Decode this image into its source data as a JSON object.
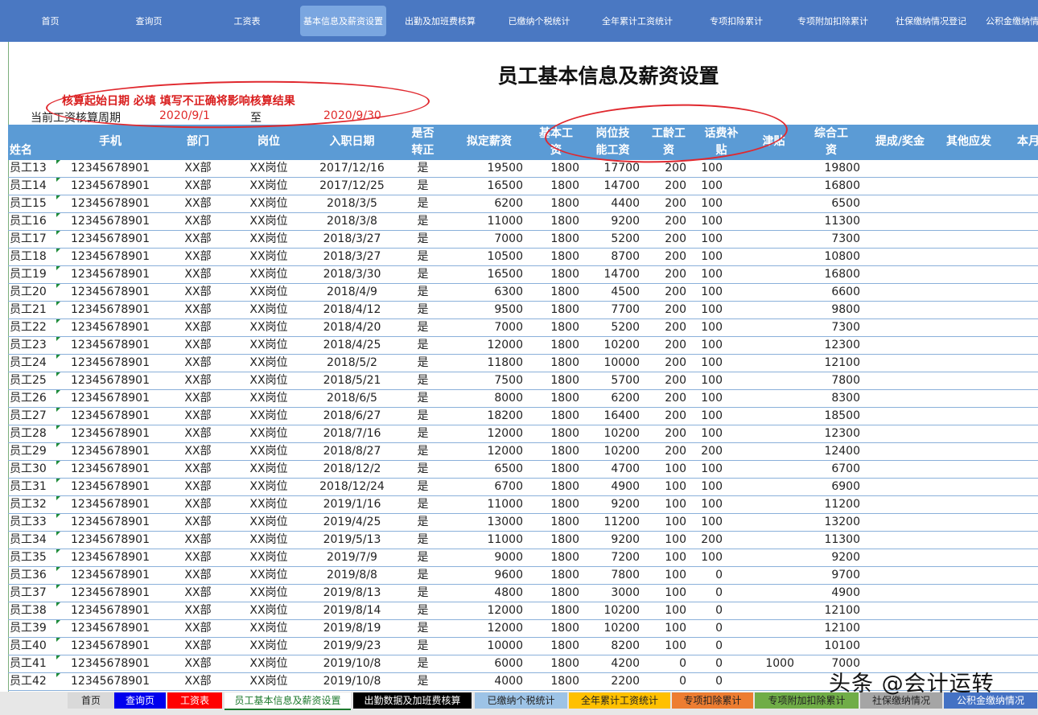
{
  "nav": {
    "items": [
      "首页",
      "查询页",
      "工资表",
      "基本信息及薪资设置",
      "出勤及加班费核算",
      "已缴纳个税统计",
      "全年累计工资统计",
      "专项扣除累计",
      "专项附加扣除累计",
      "社保缴纳情况登记",
      "公积金缴纳情"
    ],
    "active_index": 3
  },
  "page": {
    "title": "员工基本信息及薪资设置",
    "warning": "核算起始日期 必填 填写不正确将影响核算结果",
    "period_label": "当前工资核算周期",
    "period_start": "2020/9/1",
    "period_to": "至",
    "period_end": "2020/9/30"
  },
  "table": {
    "headers": [
      "姓名",
      "手机",
      "部门",
      "岗位",
      "入职日期",
      "是否\n转正",
      "拟定薪资",
      "基本工\n资",
      "岗位技\n能工资",
      "工龄工\n资",
      "话费补\n贴",
      "津贴",
      "综合工\n资",
      "提成/奖金",
      "其他应发",
      "本月"
    ],
    "rows": [
      [
        "员工13",
        "12345678901",
        "XX部",
        "XX岗位",
        "2017/12/16",
        "是",
        "19500",
        "1800",
        "17700",
        "200",
        "100",
        "",
        "19800"
      ],
      [
        "员工14",
        "12345678901",
        "XX部",
        "XX岗位",
        "2017/12/25",
        "是",
        "16500",
        "1800",
        "14700",
        "200",
        "100",
        "",
        "16800"
      ],
      [
        "员工15",
        "12345678901",
        "XX部",
        "XX岗位",
        "2018/3/5",
        "是",
        "6200",
        "1800",
        "4400",
        "200",
        "100",
        "",
        "6500"
      ],
      [
        "员工16",
        "12345678901",
        "XX部",
        "XX岗位",
        "2018/3/8",
        "是",
        "11000",
        "1800",
        "9200",
        "200",
        "100",
        "",
        "11300"
      ],
      [
        "员工17",
        "12345678901",
        "XX部",
        "XX岗位",
        "2018/3/27",
        "是",
        "7000",
        "1800",
        "5200",
        "200",
        "100",
        "",
        "7300"
      ],
      [
        "员工18",
        "12345678901",
        "XX部",
        "XX岗位",
        "2018/3/27",
        "是",
        "10500",
        "1800",
        "8700",
        "200",
        "100",
        "",
        "10800"
      ],
      [
        "员工19",
        "12345678901",
        "XX部",
        "XX岗位",
        "2018/3/30",
        "是",
        "16500",
        "1800",
        "14700",
        "200",
        "100",
        "",
        "16800"
      ],
      [
        "员工20",
        "12345678901",
        "XX部",
        "XX岗位",
        "2018/4/9",
        "是",
        "6300",
        "1800",
        "4500",
        "200",
        "100",
        "",
        "6600"
      ],
      [
        "员工21",
        "12345678901",
        "XX部",
        "XX岗位",
        "2018/4/12",
        "是",
        "9500",
        "1800",
        "7700",
        "200",
        "100",
        "",
        "9800"
      ],
      [
        "员工22",
        "12345678901",
        "XX部",
        "XX岗位",
        "2018/4/20",
        "是",
        "7000",
        "1800",
        "5200",
        "200",
        "100",
        "",
        "7300"
      ],
      [
        "员工23",
        "12345678901",
        "XX部",
        "XX岗位",
        "2018/4/25",
        "是",
        "12000",
        "1800",
        "10200",
        "200",
        "100",
        "",
        "12300"
      ],
      [
        "员工24",
        "12345678901",
        "XX部",
        "XX岗位",
        "2018/5/2",
        "是",
        "11800",
        "1800",
        "10000",
        "200",
        "100",
        "",
        "12100"
      ],
      [
        "员工25",
        "12345678901",
        "XX部",
        "XX岗位",
        "2018/5/21",
        "是",
        "7500",
        "1800",
        "5700",
        "200",
        "100",
        "",
        "7800"
      ],
      [
        "员工26",
        "12345678901",
        "XX部",
        "XX岗位",
        "2018/6/5",
        "是",
        "8000",
        "1800",
        "6200",
        "200",
        "100",
        "",
        "8300"
      ],
      [
        "员工27",
        "12345678901",
        "XX部",
        "XX岗位",
        "2018/6/27",
        "是",
        "18200",
        "1800",
        "16400",
        "200",
        "100",
        "",
        "18500"
      ],
      [
        "员工28",
        "12345678901",
        "XX部",
        "XX岗位",
        "2018/7/16",
        "是",
        "12000",
        "1800",
        "10200",
        "200",
        "100",
        "",
        "12300"
      ],
      [
        "员工29",
        "12345678901",
        "XX部",
        "XX岗位",
        "2018/8/27",
        "是",
        "12000",
        "1800",
        "10200",
        "200",
        "200",
        "",
        "12400"
      ],
      [
        "员工30",
        "12345678901",
        "XX部",
        "XX岗位",
        "2018/12/2",
        "是",
        "6500",
        "1800",
        "4700",
        "100",
        "100",
        "",
        "6700"
      ],
      [
        "员工31",
        "12345678901",
        "XX部",
        "XX岗位",
        "2018/12/24",
        "是",
        "6700",
        "1800",
        "4900",
        "100",
        "100",
        "",
        "6900"
      ],
      [
        "员工32",
        "12345678901",
        "XX部",
        "XX岗位",
        "2019/1/16",
        "是",
        "11000",
        "1800",
        "9200",
        "100",
        "100",
        "",
        "11200"
      ],
      [
        "员工33",
        "12345678901",
        "XX部",
        "XX岗位",
        "2019/4/25",
        "是",
        "13000",
        "1800",
        "11200",
        "100",
        "100",
        "",
        "13200"
      ],
      [
        "员工34",
        "12345678901",
        "XX部",
        "XX岗位",
        "2019/5/13",
        "是",
        "11000",
        "1800",
        "9200",
        "100",
        "200",
        "",
        "11300"
      ],
      [
        "员工35",
        "12345678901",
        "XX部",
        "XX岗位",
        "2019/7/9",
        "是",
        "9000",
        "1800",
        "7200",
        "100",
        "100",
        "",
        "9200"
      ],
      [
        "员工36",
        "12345678901",
        "XX部",
        "XX岗位",
        "2019/8/8",
        "是",
        "9600",
        "1800",
        "7800",
        "100",
        "0",
        "",
        "9700"
      ],
      [
        "员工37",
        "12345678901",
        "XX部",
        "XX岗位",
        "2019/8/13",
        "是",
        "4800",
        "1800",
        "3000",
        "100",
        "0",
        "",
        "4900"
      ],
      [
        "员工38",
        "12345678901",
        "XX部",
        "XX岗位",
        "2019/8/14",
        "是",
        "12000",
        "1800",
        "10200",
        "100",
        "0",
        "",
        "12100"
      ],
      [
        "员工39",
        "12345678901",
        "XX部",
        "XX岗位",
        "2019/8/19",
        "是",
        "12000",
        "1800",
        "10200",
        "100",
        "0",
        "",
        "12100"
      ],
      [
        "员工40",
        "12345678901",
        "XX部",
        "XX岗位",
        "2019/9/23",
        "是",
        "10000",
        "1800",
        "8200",
        "100",
        "0",
        "",
        "10100"
      ],
      [
        "员工41",
        "12345678901",
        "XX部",
        "XX岗位",
        "2019/10/8",
        "是",
        "6000",
        "1800",
        "4200",
        "0",
        "0",
        "1000",
        "7000"
      ],
      [
        "员工42",
        "12345678901",
        "XX部",
        "XX岗位",
        "2019/10/8",
        "是",
        "4000",
        "1800",
        "2200",
        "0",
        "0",
        "",
        ""
      ]
    ]
  },
  "sheet_tabs": [
    {
      "label": "首页",
      "bg": "#d9d9d9",
      "color": "#222"
    },
    {
      "label": "查询页",
      "bg": "#0000ee",
      "color": "#ffffff"
    },
    {
      "label": "工资表",
      "bg": "#ff0000",
      "color": "#ffffff"
    },
    {
      "label": "员工基本信息及薪资设置",
      "bg": "#ffffff",
      "color": "#1e7a2e"
    },
    {
      "label": "出勤数据及加班费核算",
      "bg": "#000000",
      "color": "#ffffff"
    },
    {
      "label": "已缴纳个税统计",
      "bg": "#9dc3e6",
      "color": "#222"
    },
    {
      "label": "全年累计工资统计",
      "bg": "#ffc000",
      "color": "#222"
    },
    {
      "label": "专项扣除累计",
      "bg": "#ed7d31",
      "color": "#222"
    },
    {
      "label": "专项附加扣除累计",
      "bg": "#70ad47",
      "color": "#222"
    },
    {
      "label": "社保缴纳情况",
      "bg": "#a5a5a5",
      "color": "#222"
    },
    {
      "label": "公积金缴纳情况",
      "bg": "#4472c4",
      "color": "#ffffff"
    }
  ],
  "watermark": "头条 @会计运转",
  "colors": {
    "nav_bg": "#4a78c2",
    "header_bg": "#5b9bd5",
    "warning": "#d91e1e",
    "annotation": "#e0282e"
  }
}
